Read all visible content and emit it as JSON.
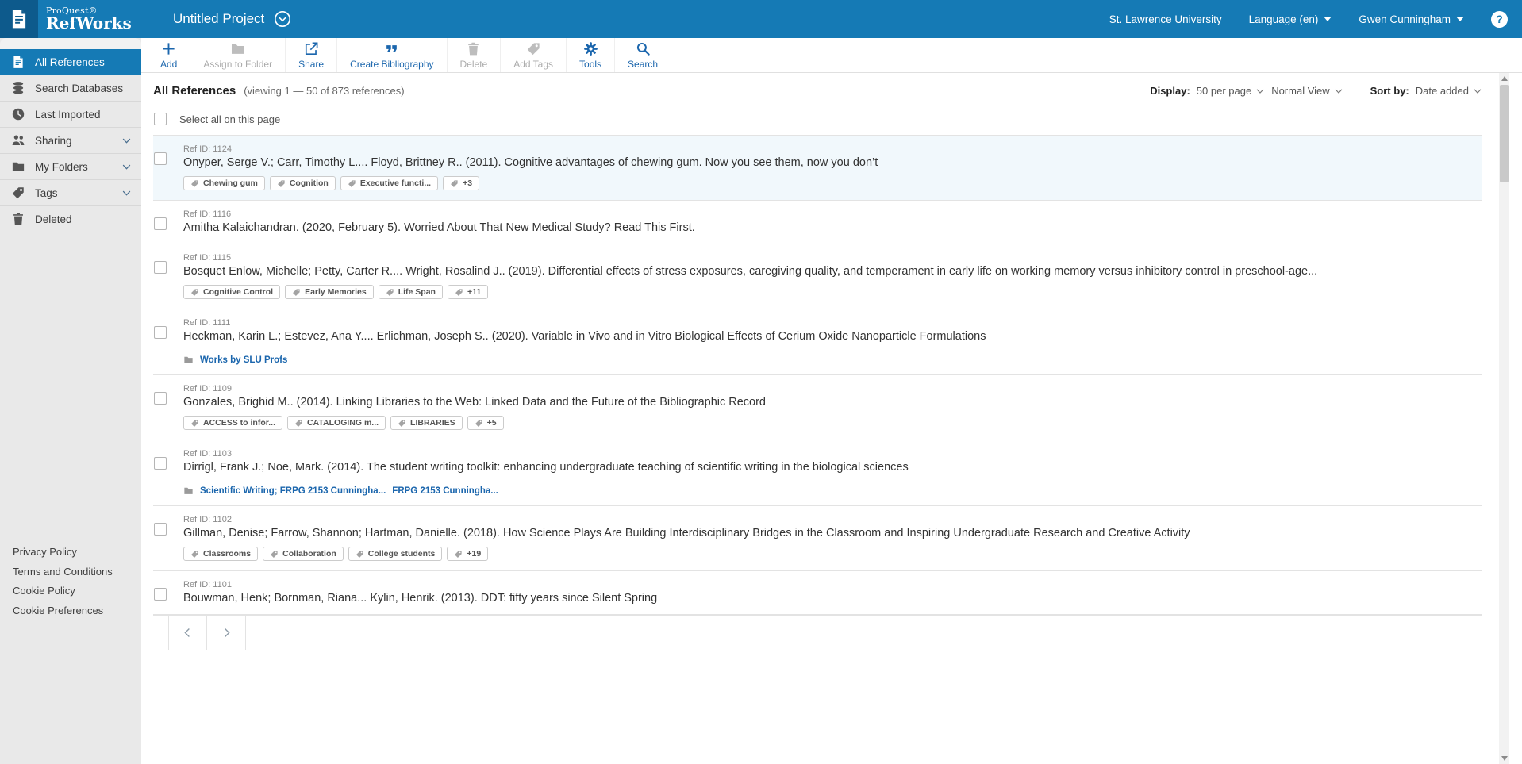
{
  "header": {
    "brand_top": "ProQuest®",
    "brand_bottom": "RefWorks",
    "project_name": "Untitled Project",
    "institution": "St. Lawrence University",
    "language": "Language (en)",
    "user_name": "Gwen Cunningham",
    "help": "?"
  },
  "toolbar": {
    "items": [
      {
        "label": "Add",
        "icon": "plus-icon",
        "enabled": true
      },
      {
        "label": "Assign to Folder",
        "icon": "folder-icon",
        "enabled": false
      },
      {
        "label": "Share",
        "icon": "share-icon",
        "enabled": true
      },
      {
        "label": "Create Bibliography",
        "icon": "quotes-icon",
        "enabled": true
      },
      {
        "label": "Delete",
        "icon": "trash-icon",
        "enabled": false
      },
      {
        "label": "Add Tags",
        "icon": "tag-icon",
        "enabled": false
      },
      {
        "label": "Tools",
        "icon": "gear-icon",
        "enabled": true
      },
      {
        "label": "Search",
        "icon": "magnifier-icon",
        "enabled": true
      }
    ]
  },
  "sidebar": {
    "items": [
      {
        "label": "All References",
        "icon": "document-icon",
        "active": true,
        "chevron": false
      },
      {
        "label": "Search Databases",
        "icon": "database-icon",
        "active": false,
        "chevron": false
      },
      {
        "label": "Last Imported",
        "icon": "clock-icon",
        "active": false,
        "chevron": false
      },
      {
        "label": "Sharing",
        "icon": "people-icon",
        "active": false,
        "chevron": true
      },
      {
        "label": "My Folders",
        "icon": "folder-icon",
        "active": false,
        "chevron": true
      },
      {
        "label": "Tags",
        "icon": "tag-icon",
        "active": false,
        "chevron": true
      },
      {
        "label": "Deleted",
        "icon": "trash-icon",
        "active": false,
        "chevron": false
      }
    ],
    "footer_links": [
      "Privacy Policy",
      "Terms and Conditions",
      "Cookie Policy",
      "Cookie Preferences"
    ]
  },
  "list_header": {
    "title": "All References",
    "viewing": "(viewing 1 — 50 of 873 references)",
    "display_label": "Display:",
    "per_page": "50 per page",
    "view_mode": "Normal View",
    "sort_label": "Sort by:",
    "sort_value": "Date added"
  },
  "select_all_label": "Select all on this page",
  "references": [
    {
      "ref_id": "Ref ID: 1124",
      "citation": "Onyper, Serge V.; Carr, Timothy L.... Floyd, Brittney R.. (2011). Cognitive advantages of chewing gum. Now you see them, now you don’t",
      "tags": [
        "Chewing gum",
        "Cognition",
        "Executive functi...",
        "+3"
      ],
      "folders": []
    },
    {
      "ref_id": "Ref ID: 1116",
      "citation": "Amitha Kalaichandran. (2020, February 5). Worried About That New Medical Study? Read This First.",
      "tags": [],
      "folders": []
    },
    {
      "ref_id": "Ref ID: 1115",
      "citation": "Bosquet Enlow, Michelle; Petty, Carter R.... Wright, Rosalind J.. (2019). Differential effects of stress exposures, caregiving quality, and temperament in early life on working memory versus inhibitory control in preschool-age...",
      "tags": [
        "Cognitive Control",
        "Early Memories",
        "Life Span",
        "+11"
      ],
      "folders": []
    },
    {
      "ref_id": "Ref ID: 1111",
      "citation": "Heckman, Karin L.; Estevez, Ana Y.... Erlichman, Joseph S.. (2020). Variable in Vivo and in Vitro Biological Effects of Cerium Oxide Nanoparticle Formulations",
      "tags": [],
      "folders": [
        "Works by SLU Profs"
      ]
    },
    {
      "ref_id": "Ref ID: 1109",
      "citation": "Gonzales, Brighid M.. (2014). Linking Libraries to the Web: Linked Data and the Future of the Bibliographic Record",
      "tags": [
        "ACCESS to infor...",
        "CATALOGING m...",
        "LIBRARIES",
        "+5"
      ],
      "folders": []
    },
    {
      "ref_id": "Ref ID: 1103",
      "citation": "Dirrigl, Frank J.; Noe, Mark. (2014). The student writing toolkit: enhancing undergraduate teaching of scientific writing in the biological sciences",
      "tags": [],
      "folders": [
        "Scientific Writing; FRPG 2153 Cunningha...",
        "FRPG 2153 Cunningha..."
      ]
    },
    {
      "ref_id": "Ref ID: 1102",
      "citation": "Gillman, Denise; Farrow, Shannon; Hartman, Danielle. (2018). How Science Plays Are Building Interdisciplinary Bridges in the Classroom and Inspiring Undergraduate Research and Creative Activity",
      "tags": [
        "Classrooms",
        "Collaboration",
        "College students",
        "+19"
      ],
      "folders": []
    },
    {
      "ref_id": "Ref ID: 1101",
      "citation": "Bouwman, Henk; Bornman, Riana... Kylin, Henrik. (2013). DDT: fifty years since Silent Spring",
      "tags": [],
      "folders": []
    }
  ],
  "colors": {
    "header_blue": "#157ab5",
    "logo_dark_blue": "#0d5a8c",
    "accent_blue": "#1b66ad",
    "active_row_highlight": "#f1f8fc",
    "sidebar_gray": "#e9e9e9"
  }
}
